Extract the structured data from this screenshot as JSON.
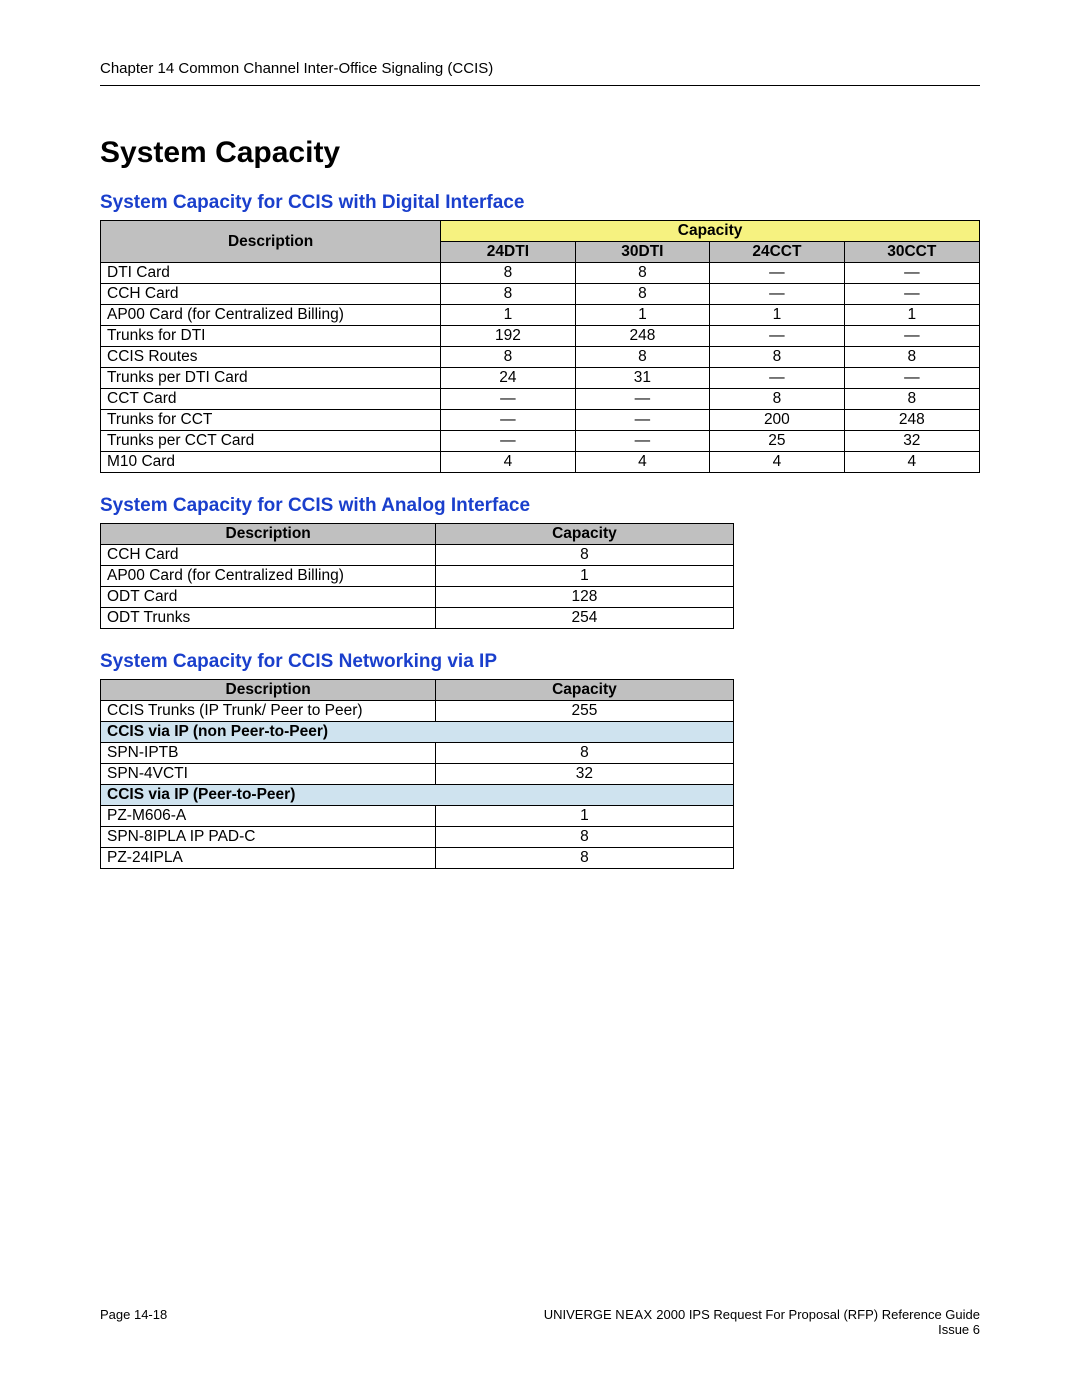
{
  "header": {
    "running": "Chapter 14 Common Channel Inter-Office Signaling (CCIS)"
  },
  "title": "System Capacity",
  "sections": {
    "digital": {
      "heading": "System Capacity for CCIS with Digital Interface",
      "desc_header": "Description",
      "cap_header": "Capacity",
      "cols": [
        "24DTI",
        "30DTI",
        "24CCT",
        "30CCT"
      ],
      "rows": [
        {
          "desc": "DTI Card",
          "v": [
            "8",
            "8",
            "—",
            "—"
          ]
        },
        {
          "desc": "CCH Card",
          "v": [
            "8",
            "8",
            "—",
            "—"
          ]
        },
        {
          "desc": "AP00 Card (for Centralized Billing)",
          "v": [
            "1",
            "1",
            "1",
            "1"
          ]
        },
        {
          "desc": "Trunks for DTI",
          "v": [
            "192",
            "248",
            "—",
            "—"
          ]
        },
        {
          "desc": "CCIS Routes",
          "v": [
            "8",
            "8",
            "8",
            "8"
          ]
        },
        {
          "desc": "Trunks per DTI Card",
          "v": [
            "24",
            "31",
            "—",
            "—"
          ]
        },
        {
          "desc": "CCT Card",
          "v": [
            "—",
            "—",
            "8",
            "8"
          ]
        },
        {
          "desc": "Trunks for CCT",
          "v": [
            "—",
            "—",
            "200",
            "248"
          ]
        },
        {
          "desc": "Trunks per CCT Card",
          "v": [
            "—",
            "—",
            "25",
            "32"
          ]
        },
        {
          "desc": "M10 Card",
          "v": [
            "4",
            "4",
            "4",
            "4"
          ]
        }
      ]
    },
    "analog": {
      "heading": "System Capacity for CCIS with Analog Interface",
      "desc_header": "Description",
      "cap_header": "Capacity",
      "rows": [
        {
          "desc": "CCH Card",
          "v": "8"
        },
        {
          "desc": "AP00 Card (for Centralized Billing)",
          "v": "1"
        },
        {
          "desc": "ODT Card",
          "v": "128"
        },
        {
          "desc": "ODT Trunks",
          "v": "254"
        }
      ]
    },
    "ip": {
      "heading": "System Capacity for CCIS Networking via IP",
      "desc_header": "Description",
      "cap_header": "Capacity",
      "rows": [
        {
          "type": "row",
          "desc": "CCIS Trunks (IP Trunk/ Peer to Peer)",
          "v": "255"
        },
        {
          "type": "sub",
          "desc": "CCIS via IP (non Peer-to-Peer)"
        },
        {
          "type": "row",
          "desc": "SPN-IPTB",
          "v": "8"
        },
        {
          "type": "row",
          "desc": "SPN-4VCTI",
          "v": "32"
        },
        {
          "type": "sub",
          "desc": "CCIS via IP (Peer-to-Peer)"
        },
        {
          "type": "row",
          "desc": "PZ-M606-A",
          "v": "1"
        },
        {
          "type": "row",
          "desc": "SPN-8IPLA IP PAD-C",
          "v": "8"
        },
        {
          "type": "row",
          "desc": "PZ-24IPLA",
          "v": "8"
        }
      ]
    }
  },
  "footer": {
    "page": "Page 14-18",
    "product_prefix": "UNIVERGE ",
    "product_neax": "NEAX",
    "product_suffix": " 2000 IPS Request For Proposal (RFP) Reference Guide",
    "issue": "Issue 6"
  }
}
